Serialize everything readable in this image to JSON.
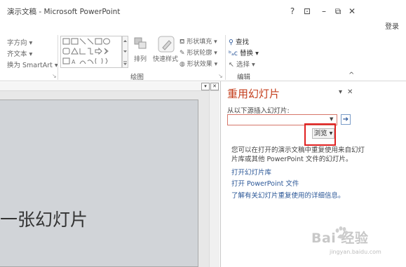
{
  "window": {
    "title": "演示文稿 - Microsoft PowerPoint",
    "help_icon": "?",
    "ribbon_display_icon": "⊡",
    "minimize_icon": "–",
    "restore_icon": "⧉",
    "close_icon": "✕",
    "sign_in": "登录"
  },
  "ribbon": {
    "paragraph": {
      "text_direction": "字方向 ▾",
      "align_text": "齐文本 ▾",
      "convert_smartart": "换为 SmartArt ▾"
    },
    "drawing": {
      "arrange": "排列",
      "quick_styles": "快速样式",
      "shape_fill": "形状填充 ▾",
      "shape_outline": "形状轮廓 ▾",
      "shape_effects": "形状效果 ▾",
      "group_label": "绘图"
    },
    "editing": {
      "find": "查找",
      "replace": "替换",
      "select": "选择 ▾",
      "group_label": "编辑",
      "collapse_icon": "^"
    }
  },
  "slide": {
    "title_text": "一张幻灯片"
  },
  "task_pane": {
    "title": "重用幻灯片",
    "insert_from_label": "从以下源插入幻灯片:",
    "source_value": "",
    "browse_label": "浏览",
    "description": "您可以在打开的演示文稿中重复使用来自幻灯片库或其他 PowerPoint 文件的幻灯片。",
    "link_open_library": "打开幻灯片库",
    "link_open_file": "打开 PowerPoint 文件",
    "link_learn_more": "了解有关幻灯片重复使用的详细信息。"
  },
  "watermark": {
    "text": "Bai  经验",
    "sub": "jingyan.baidu.com"
  },
  "colors": {
    "accent_title": "#c43e1c",
    "link": "#2b5797",
    "highlight": "#e02020",
    "slide_bg": "#d1d4d8"
  }
}
